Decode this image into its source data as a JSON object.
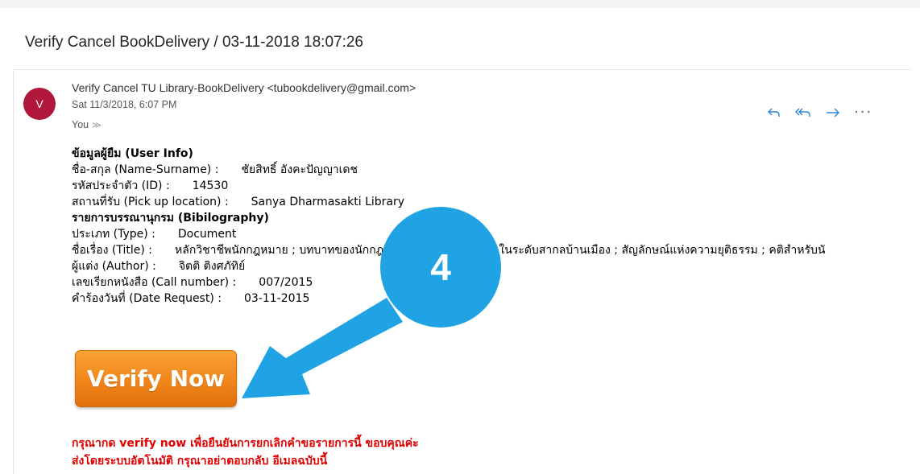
{
  "subject": "Verify Cancel BookDelivery / 03-11-2018 18:07:26",
  "message": {
    "avatar_initial": "V",
    "sender": "Verify Cancel TU Library-BookDelivery <tubookdelivery@gmail.com>",
    "date": "Sat 11/3/2018, 6:07 PM",
    "to": "You",
    "actions": [
      "reply-icon",
      "reply-all-icon",
      "forward-icon",
      "more-icon"
    ]
  },
  "body": {
    "user_info_header": "ข้อมูลผู้ยืม (User Info)",
    "name_label": "ชื่อ-สกุล (Name-Surname) :",
    "name_value": "ชัยสิทธิ์ อังคะปัญญาเดช",
    "id_label": "รหัสประจำตัว (ID) :",
    "id_value": "14530",
    "pickup_label": "สถานที่รับ (Pick up location) :",
    "pickup_value": "Sanya Dharmasakti Library",
    "biblio_header": "รายการบรรณานุกรม (Bibilography)",
    "type_label": "ประเภท (Type) :",
    "type_value": "Document",
    "title_label": "ชื่อเรื่อง (Title) :",
    "title_value": "หลักวิชาชีพนักกฎหมาย ; บทบาทของนักกฎหมายในภาคเอกชนและในระดับสากลบ้านเมือง ; สัญลักษณ์แห่งความยุติธรรม ; คติสำหรับนั",
    "author_label": "ผู้แต่ง (Author) :",
    "author_value": "จิตติ ติงศภัทิย์",
    "call_label": "เลขเรียกหนังสือ (Call number) :",
    "call_value": "007/2015",
    "date_label": "คำร้องวันที่ (Date Request) :",
    "date_value": "03-11-2015"
  },
  "verify_button": "Verify Now",
  "notes": {
    "line1": "กรุณากด verify now เพื่อยืนยันการยกเลิกคำขอรายการนี้ ขอบคุณค่ะ",
    "line2": "ส่งโดยระบบอัตโนมัติ กรุณาอย่าตอบกลับ อีเมลฉบับนี้"
  },
  "annotation": {
    "step_number": "4",
    "color": "#1fa3e4"
  }
}
